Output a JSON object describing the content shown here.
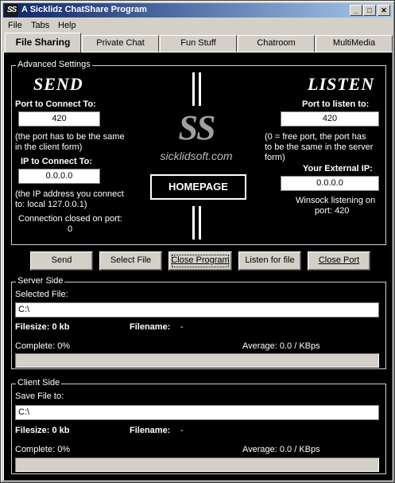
{
  "window": {
    "icon_text": "SS",
    "title": "A Sicklidz ChatShare Program",
    "buttons": {
      "minimize": "_",
      "maximize": "□",
      "close": "✕"
    }
  },
  "menu": {
    "items": [
      {
        "label": "File"
      },
      {
        "label": "Tabs"
      },
      {
        "label": "Help"
      }
    ]
  },
  "tabs": [
    {
      "label": "File Sharing",
      "active": true
    },
    {
      "label": "Private Chat"
    },
    {
      "label": "Fun Stuff"
    },
    {
      "label": "Chatroom"
    },
    {
      "label": "MultiMedia"
    }
  ],
  "advanced": {
    "group_label": "Advanced Settings",
    "send": {
      "title": "SEND",
      "port_label": "Port to Connect To:",
      "port_value": "420",
      "port_note_1": "(the port has to be the same",
      "port_note_2": "in the client form)",
      "ip_label": "IP to Connect To:",
      "ip_value": "0.0.0.0",
      "ip_note_1": "(the IP address you connect",
      "ip_note_2": "to: local 127.0.0.1)",
      "status_1": "Connection closed on port:",
      "status_2": "0"
    },
    "center": {
      "logo_text": "SS",
      "site": "sicklidsoft.com",
      "homepage_button": "HOMEPAGE"
    },
    "listen": {
      "title": "LISTEN",
      "port_label": "Port to listen to:",
      "port_value": "420",
      "port_note_1": "(0 = free port, the port has",
      "port_note_2": "to be the same in the server",
      "port_note_3": "form)",
      "ext_ip_label": "Your External IP:",
      "ext_ip_value": "0.0.0.0",
      "status_1": "Winsock listening on",
      "status_2": "port: 420"
    }
  },
  "buttons": {
    "send": "Send",
    "select_file": "Select File",
    "close_program": "Close Program",
    "listen_for_file": "Listen for file",
    "close_port": "Close Port"
  },
  "server": {
    "group_label": "Server Side",
    "file_label": "Selected File:",
    "file_value": "C:\\",
    "filesize": "Filesize: 0 kb",
    "filename_label": "Filename:",
    "filename_value": "-",
    "complete": "Complete: 0%",
    "average": "Average: 0.0 / KBps",
    "progress": 0
  },
  "client": {
    "group_label": "Client Side",
    "file_label": "Save File to:",
    "file_value": "C:\\",
    "filesize": "Filesize: 0 kb",
    "filename_label": "Filename:",
    "filename_value": "-",
    "complete": "Complete: 0%",
    "average": "Average: 0.0 / KBps",
    "progress": 0
  }
}
